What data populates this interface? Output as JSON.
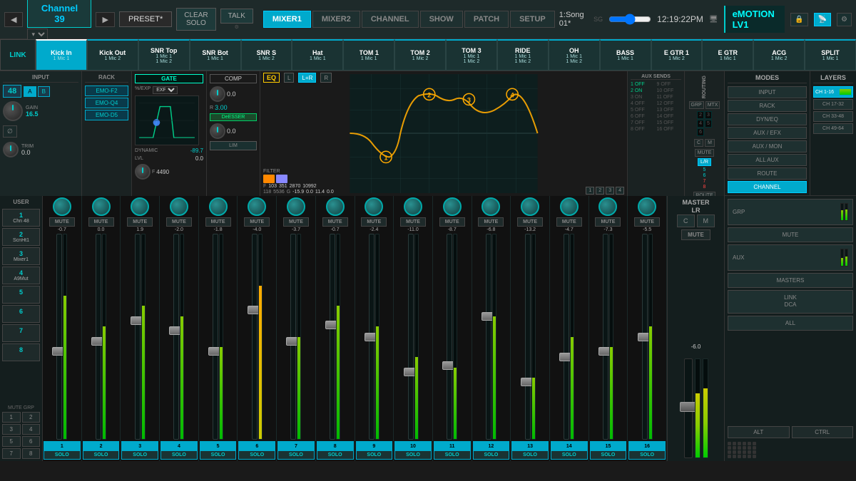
{
  "app": {
    "title": "Channel 39",
    "brand": "eMOTION LV1",
    "clock": "12:19:22PM",
    "song": "1:Song 01*",
    "sg_label": "SG"
  },
  "toolbar": {
    "preset_label": "PRESET*",
    "clear_solo": "CLEAR\nSOLO",
    "talk": "TALK",
    "tabs": [
      "MIXER1",
      "MIXER2",
      "CHANNEL",
      "SHOW",
      "PATCH",
      "SETUP"
    ],
    "active_tab": "MIXER1"
  },
  "nav": {
    "prev": "◀",
    "next": "▶",
    "dropdown": "▾"
  },
  "channels": [
    {
      "name": "Kick In",
      "src1": "1 Mic 1"
    },
    {
      "name": "Kick Out",
      "src1": "1 Mic 2"
    },
    {
      "name": "SNR Top",
      "src1": "1 Mic 1",
      "src2": "1 Mic 2"
    },
    {
      "name": "SNR Bot",
      "src1": "1 Mic 1"
    },
    {
      "name": "SNR S",
      "src1": "1 Mic 2"
    },
    {
      "name": "Hat",
      "src1": "1 Mic 1"
    },
    {
      "name": "TOM 1",
      "src1": "1 Mic 1"
    },
    {
      "name": "TOM 2",
      "src1": "1 Mic 2"
    },
    {
      "name": "TOM 3",
      "src1": "1 Mic 1",
      "src2": "1 Mic 2"
    },
    {
      "name": "RIDE",
      "src1": "1 Mic 1",
      "src2": "1 Mic 2"
    },
    {
      "name": "OH",
      "src1": "1 Mic 1",
      "src2": "1 Mic 2"
    },
    {
      "name": "BASS",
      "src1": "1 Mic 1"
    },
    {
      "name": "E GTR 1",
      "src1": "1 Mic 2"
    },
    {
      "name": "E GTR",
      "src1": "1 Mic 1"
    },
    {
      "name": "ACG",
      "src1": "1 Mic 2"
    },
    {
      "name": "SPLIT",
      "src1": "1 Mic 1"
    }
  ],
  "dsp": {
    "gain": "16.5",
    "gain_label": "GAIN",
    "trim": "0.0",
    "trim_label": "TRIM",
    "input_num": "48",
    "rack_items": [
      "EMO-F2",
      "EMO-Q4",
      "EMO-D5"
    ],
    "gate_label": "GATE",
    "gate_dynamic": "DYNAMIC",
    "gate_lvl": "LVL",
    "gate_lvl_val": "0.0",
    "gate_exp_label": "%/EXP",
    "gate_val": "-89.7",
    "gate_f": "F",
    "gate_f_val": "4490",
    "comp_label": "COMP",
    "comp_val": "0.0",
    "comp_r": "R",
    "comp_r_val": "3.00",
    "comp_lim": "LIM",
    "deeser": "DeESSER",
    "deeser_val": "0.0",
    "eq_label": "EQ",
    "filter_label": "FILTER",
    "eq_bands": [
      {
        "num": 1,
        "freq": 118,
        "gain": -15.9
      },
      {
        "num": 2,
        "freq": 5536,
        "gain": 0.0
      },
      {
        "num": 3,
        "freq": 351,
        "gain": 11.4
      },
      {
        "num": 4,
        "freq": 103,
        "freq2": 2870,
        "freq3": 10992
      }
    ]
  },
  "fader_channels": [
    {
      "num": 1,
      "value": "-0.7",
      "meter": 70,
      "muted": false
    },
    {
      "num": 2,
      "value": "0.0",
      "meter": 55,
      "muted": false
    },
    {
      "num": 3,
      "value": "1.9",
      "meter": 65,
      "muted": false
    },
    {
      "num": 4,
      "value": "-2.0",
      "meter": 60,
      "muted": false
    },
    {
      "num": 5,
      "value": "-1.8",
      "meter": 45,
      "muted": false
    },
    {
      "num": 6,
      "value": "-4.0",
      "meter": 75,
      "muted": false
    },
    {
      "num": 7,
      "value": "-3.7",
      "meter": 50,
      "muted": false
    },
    {
      "num": 8,
      "value": "-0.7",
      "meter": 65,
      "muted": false
    },
    {
      "num": 9,
      "value": "-2.4",
      "meter": 55,
      "muted": false
    },
    {
      "num": 10,
      "value": "-11.0",
      "meter": 40,
      "muted": false
    },
    {
      "num": 11,
      "value": "-8.7",
      "meter": 35,
      "muted": false
    },
    {
      "num": 12,
      "value": "-6.8",
      "meter": 60,
      "muted": false
    },
    {
      "num": 13,
      "value": "-13.2",
      "meter": 30,
      "muted": false
    },
    {
      "num": 14,
      "value": "-4.7",
      "meter": 50,
      "muted": false
    },
    {
      "num": 15,
      "value": "-7.3",
      "meter": 45,
      "muted": false
    },
    {
      "num": 16,
      "value": "-5.5",
      "meter": 55,
      "muted": false
    }
  ],
  "user_presets": [
    {
      "num": "1",
      "name": "Chn 48"
    },
    {
      "num": "2",
      "name": "ScnHt1"
    },
    {
      "num": "3",
      "name": "Mixer1"
    },
    {
      "num": "4",
      "name": "A9Mut"
    },
    {
      "num": "5",
      "name": ""
    },
    {
      "num": "6",
      "name": ""
    },
    {
      "num": "7",
      "name": ""
    },
    {
      "num": "8",
      "name": ""
    }
  ],
  "mute_groups": [
    "1",
    "2",
    "3",
    "4",
    "5",
    "6",
    "7",
    "8"
  ],
  "modes": {
    "title": "MODES",
    "items": [
      "INPUT",
      "RACK",
      "DYN/EQ",
      "AUX / EFX",
      "AUX / MON",
      "ALL AUX",
      "ROUTE",
      "CHANNEL"
    ]
  },
  "layers": {
    "title": "LAYERS",
    "items": [
      "CH 1-16",
      "CH 17-32",
      "CH 33-48",
      "CH 49-64"
    ]
  },
  "master": {
    "title": "MASTER\nLR",
    "c_label": "C",
    "m_label": "M",
    "mute": "MUTE",
    "value": "-6.0"
  },
  "right_panel": {
    "grp": "GRP",
    "mute": "MUTE",
    "aux": "AUX",
    "masters": "MASTERS",
    "link_dca": "LINK\nDCA",
    "all": "ALL",
    "alt": "ALT",
    "ctrl": "CTRL"
  },
  "link_label": "LINK",
  "labels": {
    "mute": "MUTE",
    "solo": "SOLO",
    "user": "USER",
    "mute_grp": "MUTE GRP",
    "in": "IN",
    "aux_sends": "AUX SENDS",
    "routing": "ROUTING"
  }
}
